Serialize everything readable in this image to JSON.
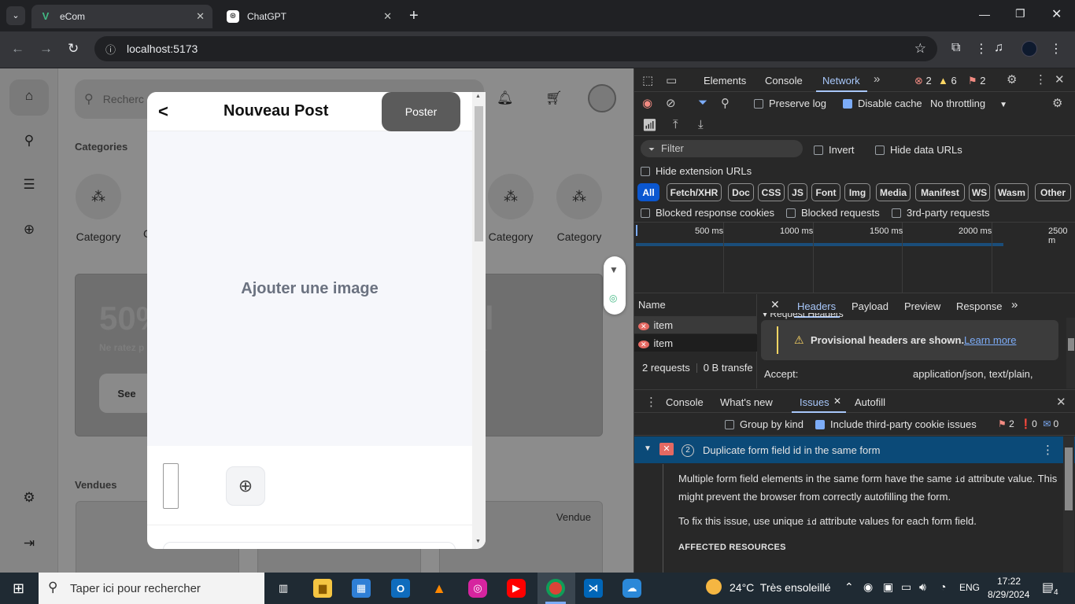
{
  "tabs": [
    {
      "title": "eCom",
      "icon": "vue-logo-icon",
      "active": true
    },
    {
      "title": "ChatGPT",
      "icon": "chatgpt-logo-icon",
      "active": false
    }
  ],
  "address": {
    "url": "localhost:5173"
  },
  "page": {
    "search_placeholder": "Recherc",
    "categories_title": "Categories",
    "category_label": "Category",
    "category_partial": "C",
    "banner": {
      "big": "50%",
      "big_right": "l",
      "sub": "Ne ratez p",
      "sub_right": ".",
      "button": "See"
    },
    "sold_title": "Vendues",
    "sold_badge": "Vendue"
  },
  "modal": {
    "title": "Nouveau Post",
    "post_button": "Poster",
    "add_image": "Ajouter une image"
  },
  "devtools": {
    "tabs": [
      "Elements",
      "Console",
      "Network"
    ],
    "active_tab": "Network",
    "errors": "2",
    "warnings": "6",
    "issues": "2",
    "preserve_log": "Preserve log",
    "disable_cache": "Disable cache",
    "throttling": "No throttling",
    "filter_placeholder": "Filter",
    "invert": "Invert",
    "hide_data_urls": "Hide data URLs",
    "hide_extension_urls": "Hide extension URLs",
    "type_filters": [
      "All",
      "Fetch/XHR",
      "Doc",
      "CSS",
      "JS",
      "Font",
      "Img",
      "Media",
      "Manifest",
      "WS",
      "Wasm",
      "Other"
    ],
    "blocked_cookies": "Blocked response cookies",
    "blocked_requests": "Blocked requests",
    "third_party": "3rd-party requests",
    "timeline_ticks": [
      "500 ms",
      "1000 ms",
      "1500 ms",
      "2000 ms",
      "2500 m"
    ],
    "name_header": "Name",
    "requests": [
      {
        "name": "item"
      },
      {
        "name": "item"
      }
    ],
    "summary": "2 requests",
    "transfer": "0 B transfe",
    "detail_tabs": [
      "Headers",
      "Payload",
      "Preview",
      "Response"
    ],
    "request_headers": "Request Headers",
    "provisional": "Provisional headers are shown.",
    "learn_more": "Learn more",
    "accept_key": "Accept:",
    "accept_value": "application/json, text/plain,",
    "drawer_tabs": [
      "Console",
      "What's new",
      "Issues",
      "Autofill"
    ],
    "group_by_kind": "Group by kind",
    "include_third_party": "Include third-party cookie issues",
    "issue_counts": {
      "errors": "2",
      "warnings": "0",
      "info": "0"
    },
    "issue_count": "2",
    "issue_title": "Duplicate form field id in the same form",
    "issue_p1_a": "Multiple form field elements in the same form have the same ",
    "issue_code": "id",
    "issue_p1_b": " attribute value. This might prevent the browser from correctly autofilling the form.",
    "issue_p2_a": "To fix this issue, use unique ",
    "issue_p2_b": " attribute values for each form field.",
    "affected": "AFFECTED RESOURCES"
  },
  "taskbar": {
    "search_placeholder": "Taper ici pour rechercher",
    "weather": "24°C  Très ensoleillé",
    "lang": "ENG",
    "time": "17:22",
    "date": "8/29/2024",
    "notifications": "4"
  },
  "colors": {
    "accent_blue": "#0b57d0",
    "issue_bar": "#0b4a78",
    "devtools_bg": "#282828",
    "modal_bg": "#ffffff"
  }
}
